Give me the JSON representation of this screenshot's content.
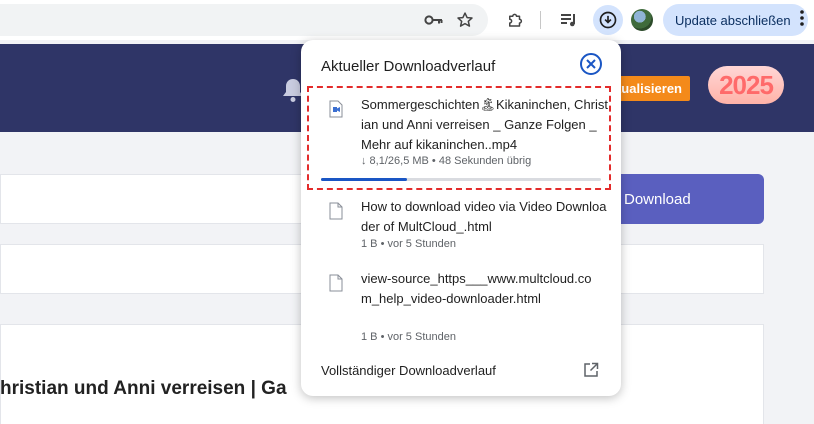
{
  "browser": {
    "update_label": "Update abschließen",
    "icons": [
      "key-icon",
      "star-icon",
      "extensions-icon",
      "media-icon",
      "download-icon",
      "profile-avatar",
      "kebab-menu-icon"
    ]
  },
  "site": {
    "update_label": "tualisieren",
    "badge_label": "2025",
    "download_label": "Download",
    "heading": "hristian und Anni verreisen | Ga"
  },
  "downloads": {
    "title": "Aktueller Downloadverlauf",
    "items": [
      {
        "name": "Sommergeschichten🏝Kikaninchen, Christian und Anni verreisen _ Ganze Folgen _ Mehr auf kikaninchen..mp4",
        "meta": "↓ 8,1/26,5 MB • 48 Sekunden übrig",
        "progress": 0.306,
        "active": true
      },
      {
        "name": "How to download video via Video Downloader of MultCloud_.html",
        "meta": "1 B • vor 5 Stunden"
      },
      {
        "name": "view-source_https___www.multcloud.com_help_video-downloader.html",
        "meta": "1 B • vor 5 Stunden"
      }
    ],
    "footer": "Vollständiger Downloadverlauf"
  },
  "colors": {
    "accent": "#1a56c4",
    "site_header": "#2f3567",
    "highlight": "#e32b2b"
  }
}
